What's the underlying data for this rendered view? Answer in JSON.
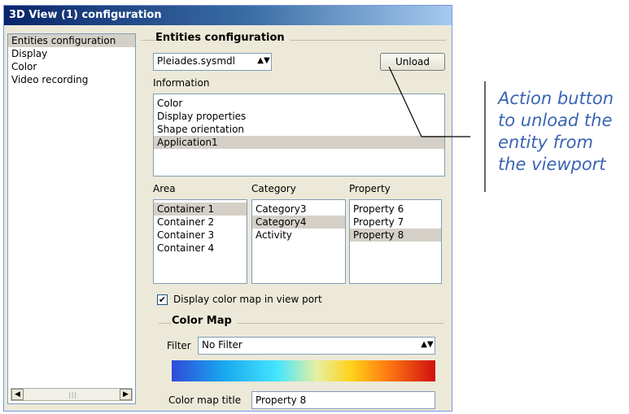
{
  "window": {
    "title": "3D View (1) configuration"
  },
  "nav": {
    "items": [
      {
        "label": "Entities configuration",
        "selected": true
      },
      {
        "label": "Display",
        "selected": false
      },
      {
        "label": "Color",
        "selected": false
      },
      {
        "label": "Video recording",
        "selected": false
      }
    ]
  },
  "entities": {
    "heading": "Entities configuration",
    "entity_select": "Pleiades.sysmdl",
    "unload_label": "Unload",
    "information_label": "Information",
    "information_items": [
      {
        "label": "Color",
        "selected": false
      },
      {
        "label": "Display properties",
        "selected": false
      },
      {
        "label": "Shape orientation",
        "selected": false
      },
      {
        "label": "Application1",
        "selected": true
      }
    ],
    "area_label": "Area",
    "area_items": [
      {
        "label": "Container 1",
        "selected": true
      },
      {
        "label": "Container 2",
        "selected": false
      },
      {
        "label": "Container 3",
        "selected": false
      },
      {
        "label": "Container 4",
        "selected": false
      }
    ],
    "category_label": "Category",
    "category_items": [
      {
        "label": "Category3",
        "selected": false
      },
      {
        "label": "Category4",
        "selected": true
      },
      {
        "label": "Activity",
        "selected": false
      }
    ],
    "property_label": "Property",
    "property_items": [
      {
        "label": "Property 6",
        "selected": false
      },
      {
        "label": "Property 7",
        "selected": false
      },
      {
        "label": "Property 8",
        "selected": true
      }
    ],
    "display_colormap_label": "Display color map in view port",
    "display_colormap_checked": true
  },
  "color_map": {
    "heading": "Color Map",
    "filter_label": "Filter",
    "filter_value": "No Filter",
    "title_label": "Color map title",
    "title_value": "Property 8"
  },
  "annotation": {
    "lines": [
      "Action button",
      "to unload the",
      "entity from",
      "the viewport"
    ],
    "color": "#3a65b3"
  }
}
